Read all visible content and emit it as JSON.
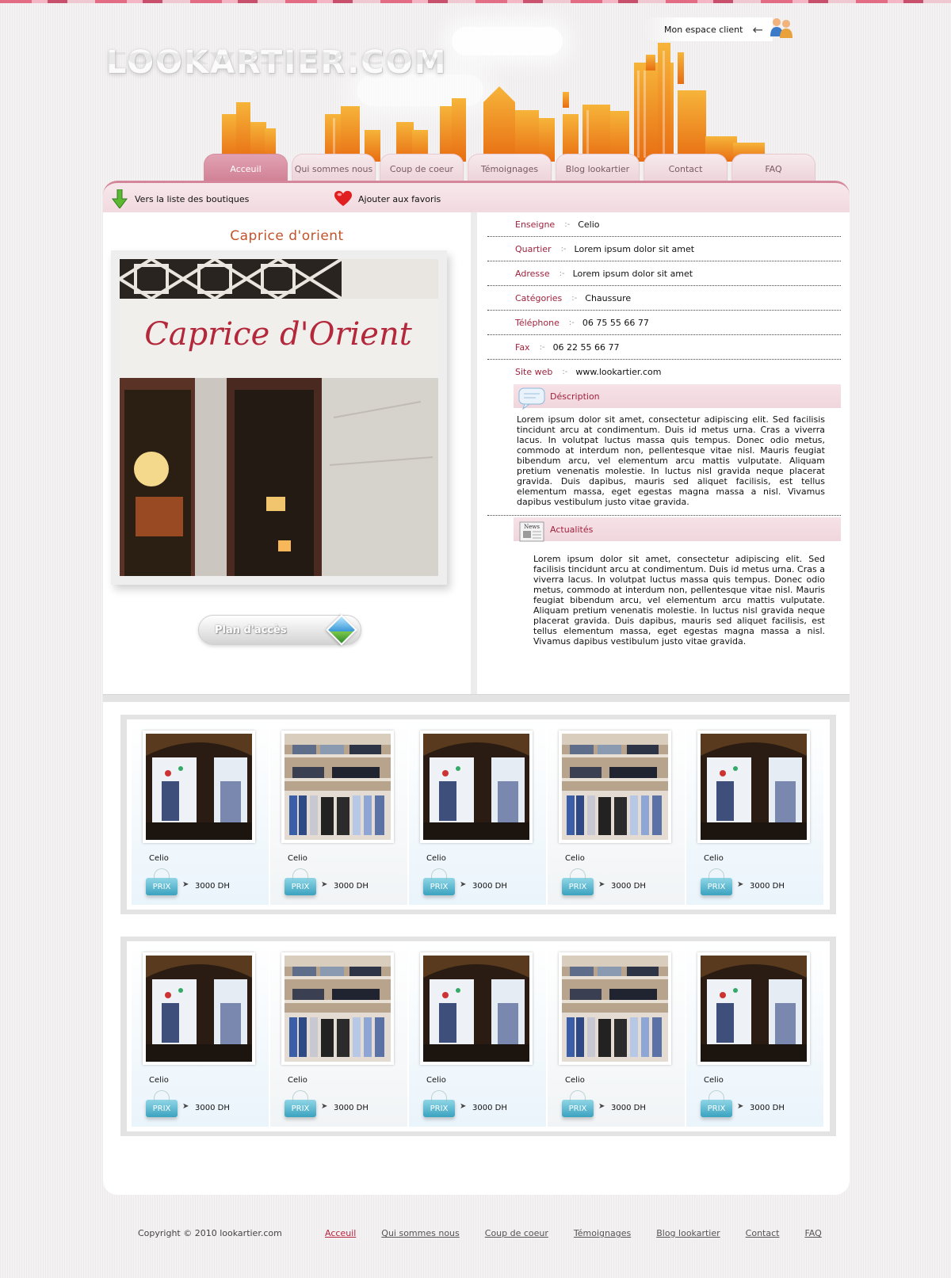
{
  "brand": {
    "logo_text": "LOOKARTIER.COM",
    "accent": "#d4879a",
    "brand_pink": "#e3a4b3",
    "title_color": "#c0542a",
    "label_color": "#a0233e"
  },
  "header": {
    "account_label": "Mon espace client"
  },
  "nav": {
    "tabs": [
      {
        "label": "Acceuil",
        "active": true
      },
      {
        "label": "Qui sommes nous",
        "active": false
      },
      {
        "label": "Coup de coeur",
        "active": false
      },
      {
        "label": "Témoignages",
        "active": false
      },
      {
        "label": "Blog lookartier",
        "active": false
      },
      {
        "label": "Contact",
        "active": false
      },
      {
        "label": "FAQ",
        "active": false
      }
    ]
  },
  "toolbar": {
    "back_label": "Vers la liste des boutiques",
    "fav_label": "Ajouter aux favoris"
  },
  "shop": {
    "title": "Caprice d'orient",
    "sign_text": "Caprice d'Orient",
    "plan_label": "Plan d'accès",
    "info": [
      {
        "label": "Enseigne",
        "value": "Celio"
      },
      {
        "label": "Quartier",
        "value": "Lorem ipsum dolor sit amet"
      },
      {
        "label": "Adresse",
        "value": "Lorem ipsum dolor sit amet"
      },
      {
        "label": "Catégories",
        "value": "Chaussure"
      },
      {
        "label": "Téléphone",
        "value": "06 75 55 66 77"
      },
      {
        "label": "Fax",
        "value": "06 22 55 66 77"
      },
      {
        "label": "Site web",
        "value": "www.lookartier.com"
      }
    ],
    "description_title": "Déscription",
    "description_text": "Lorem ipsum dolor sit amet, consectetur adipiscing elit. Sed facilisis tincidunt arcu at condimentum. Duis id metus urna. Cras a viverra lacus. In volutpat luctus massa quis tempus. Donec odio metus, commodo at interdum non, pellentesque vitae nisl. Mauris feugiat bibendum arcu, vel elementum arcu mattis vulputate. Aliquam pretium venenatis molestie. In luctus nisl gravida neque placerat gravida. Duis dapibus, mauris sed aliquet facilisis, est tellus elementum massa, eget egestas magna massa a nisl. Vivamus dapibus vestibulum justo vitae gravida.",
    "news_badge": "News",
    "news_title": "Actualités",
    "news_text": "Lorem ipsum dolor sit amet, consectetur adipiscing elit. Sed facilisis tincidunt arcu at condimentum. Duis id metus urna. Cras a viverra lacus. In volutpat luctus massa quis tempus. Donec odio metus, commodo at interdum non, pellentesque vitae nisl. Mauris feugiat bibendum arcu, vel elementum arcu mattis vulputate. Aliquam pretium venenatis molestie. In luctus nisl gravida neque placerat gravida. Duis dapibus, mauris sed aliquet facilisis, est tellus elementum massa, eget egestas magna massa a nisl. Vivamus dapibus vestibulum justo vitae gravida."
  },
  "products": {
    "rows": [
      [
        {
          "name": "Celio",
          "prix_label": "PRIX",
          "price": "3000 DH",
          "thumb": "window"
        },
        {
          "name": "Celio",
          "prix_label": "PRIX",
          "price": "3000 DH",
          "thumb": "shelves"
        },
        {
          "name": "Celio",
          "prix_label": "PRIX",
          "price": "3000 DH",
          "thumb": "window"
        },
        {
          "name": "Celio",
          "prix_label": "PRIX",
          "price": "3000 DH",
          "thumb": "shelves"
        },
        {
          "name": "Celio",
          "prix_label": "PRIX",
          "price": "3000 DH",
          "thumb": "window"
        }
      ],
      [
        {
          "name": "Celio",
          "prix_label": "PRIX",
          "price": "3000 DH",
          "thumb": "window"
        },
        {
          "name": "Celio",
          "prix_label": "PRIX",
          "price": "3000 DH",
          "thumb": "shelves"
        },
        {
          "name": "Celio",
          "prix_label": "PRIX",
          "price": "3000 DH",
          "thumb": "window"
        },
        {
          "name": "Celio",
          "prix_label": "PRIX",
          "price": "3000 DH",
          "thumb": "shelves"
        },
        {
          "name": "Celio",
          "prix_label": "PRIX",
          "price": "3000 DH",
          "thumb": "window"
        }
      ]
    ]
  },
  "footer": {
    "copyright": "Copyright © 2010 lookartier.com",
    "links": [
      {
        "label": "Acceuil",
        "active": true
      },
      {
        "label": "Qui sommes nous",
        "active": false
      },
      {
        "label": "Coup de coeur",
        "active": false
      },
      {
        "label": "Témoignages",
        "active": false
      },
      {
        "label": "Blog lookartier",
        "active": false
      },
      {
        "label": "Contact",
        "active": false
      },
      {
        "label": "FAQ",
        "active": false
      }
    ]
  }
}
